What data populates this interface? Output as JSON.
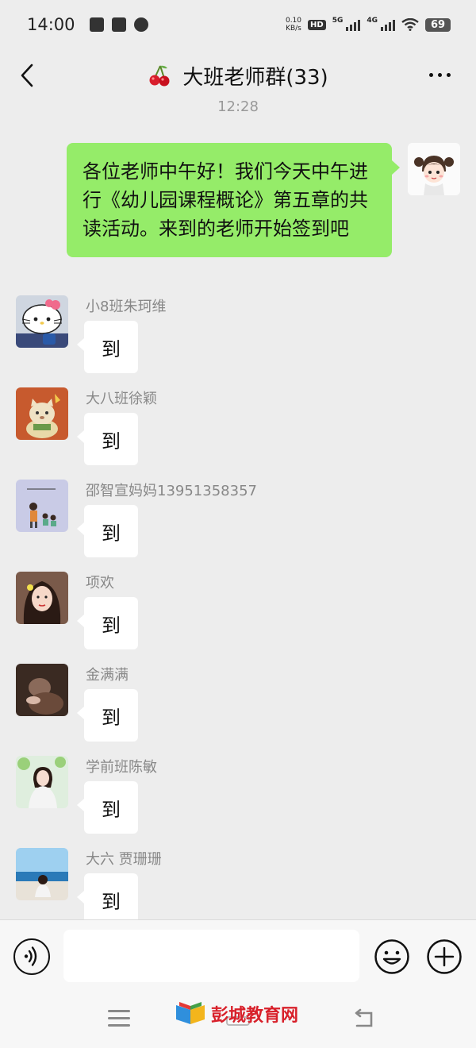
{
  "status_bar": {
    "time": "14:00",
    "net_speed_value": "0.10",
    "net_speed_unit": "KB/s",
    "hd_label": "HD",
    "signal_1": "5G",
    "signal_2": "4G",
    "battery": "69"
  },
  "header": {
    "title": "大班老师群(33)"
  },
  "chat": {
    "timestamp": "12:28",
    "self_message": "各位老师中午好！我们今天中午进行《幼儿园课程概论》第五章的共读活动。来到的老师开始签到吧",
    "messages": [
      {
        "sender": "小8班朱珂维",
        "text": "到"
      },
      {
        "sender": "大八班徐颖",
        "text": "到"
      },
      {
        "sender": "邵智宣妈妈13951358357",
        "text": "到"
      },
      {
        "sender": "项欢",
        "text": "到"
      },
      {
        "sender": "金满满",
        "text": "到"
      },
      {
        "sender": "学前班陈敏",
        "text": "到"
      },
      {
        "sender": "大六 贾珊珊",
        "text": "到"
      }
    ]
  },
  "input": {
    "value": ""
  },
  "watermark": {
    "text": "彭城教育网"
  },
  "colors": {
    "self_bubble": "#95ec69",
    "chat_bg": "#ededed",
    "watermark": "#d8202a"
  }
}
